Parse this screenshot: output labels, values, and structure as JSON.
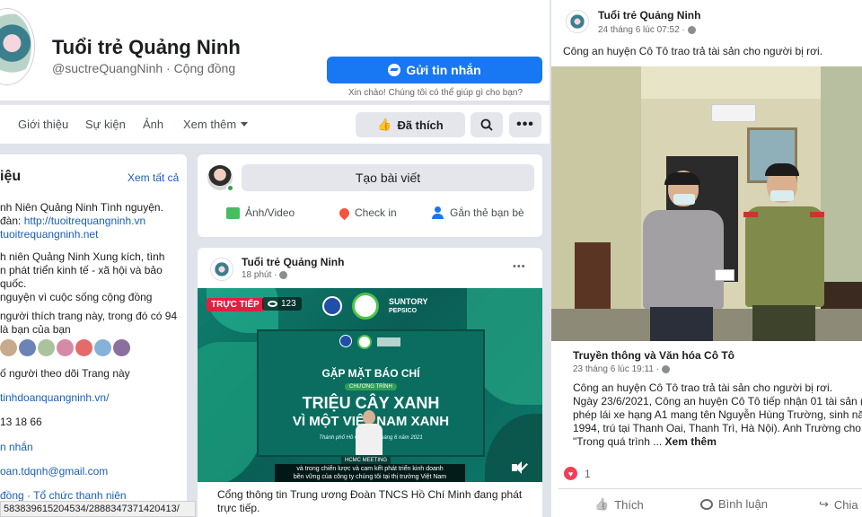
{
  "colors": {
    "accent": "#1877f2",
    "page_bg": "#dfe3ea",
    "link": "#1a5fb4",
    "live_red": "#e41e3f",
    "video_teal": "#0c6f62"
  },
  "profile": {
    "name": "Tuổi trẻ Quảng Ninh",
    "handle": "@suctreQuangNinh · Cộng đồng"
  },
  "message_button": "Gửi tin nhắn",
  "message_hint": "Xin chào! Chúng tôi có thể giúp gì cho bạn?",
  "nav": {
    "about": "Giới thiệu",
    "events": "Sự kiện",
    "photos": "Ảnh",
    "more": "Xem thêm",
    "liked": "Đã thích"
  },
  "intro": {
    "title": "iệu",
    "see_all": "Xem tất cả",
    "lines": [
      "nh Niên Quảng Ninh Tình nguyện.",
      "đàn: ",
      "tuoitrequangninh.net",
      "h niên Quảng Ninh Xung kích, tình",
      "n phát triển kinh tế - xã hội và bảo",
      "quốc.",
      "nguyện vì cuộc sống cộng đồng",
      "người thích trang này, trong đó có 94",
      "là bạn của bạn",
      "ố người theo dõi Trang này",
      "tinhdoanquangninh.vn/",
      "13 18 66",
      "n nhắn",
      "oan.tdqnh@gmail.com",
      "đồng · Tổ chức thanh niên"
    ],
    "link_inline": "http://tuoitrequangninh.vn",
    "status_url": "5838396152045​34/2888347371420413/"
  },
  "composer": {
    "create_post": "Tạo bài viết",
    "photo_video": "Ảnh/Video",
    "check_in": "Check in",
    "tag_friends": "Gắn thẻ bạn bè"
  },
  "post1": {
    "author": "Tuổi trẻ Quảng Ninh",
    "time": "18 phút ·",
    "live_label": "TRỰC TIẾP",
    "viewers": "123",
    "brand1": "SUNTORY",
    "brand2": "PEPSICO",
    "screen_title": "GẶP MẶT BÁO CHÍ",
    "screen_program": "CHƯƠNG TRÌNH",
    "screen_line1": "TRIỆU CÂY XANH",
    "screen_line2": "VÌ MỘT VIỆT NAM XANH",
    "screen_date": "Thành phố Hồ Chí Minh, tháng 6 năm 2021",
    "meeting_tag": "HCMC MEETING",
    "subtitle1": "và trong chiến lược và cam kết phát triển kinh doanh",
    "subtitle2": "bền vững của công ty chúng tôi tại thị trường Việt Nam",
    "caption": "Cổng thông tin Trung ương Đoàn TNCS Hồ Chí Minh đang phát trực tiếp."
  },
  "post2": {
    "author": "Tuổi trẻ Quảng Ninh",
    "time": "24 tháng 6 lúc 07:52 ·",
    "text": "Công an huyện Cô Tô trao trả tài sản cho người bị rơi.",
    "shared_author": "Truyền thông và Văn hóa Cô Tô",
    "shared_time": "23 tháng 6 lúc 19:11 ·",
    "shared_lines": [
      "Công an huyện Cô Tô trao trả tài sản cho người bị rơi.",
      "Ngày 23/6/2021, Công an huyện Cô Tô tiếp nhận 01 tài sản (",
      "phép lái xe hạng A1 mang tên Nguyễn Hùng Trường, sinh nă",
      "1994, trú tại Thanh Oai, Thanh Trì, Hà Nội). Anh Trường cho b",
      "\"Trong quá trình ... "
    ],
    "see_more": "Xem thêm",
    "reaction_count": "1",
    "like": "Thích",
    "comment": "Bình luận",
    "share": "Chia"
  }
}
